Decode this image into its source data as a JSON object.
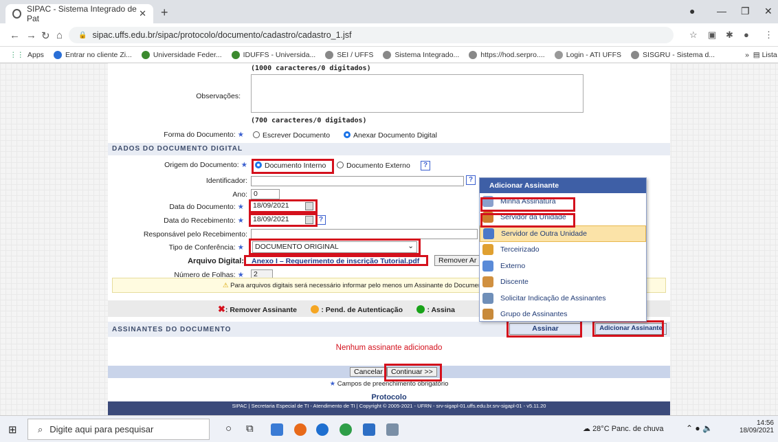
{
  "browser": {
    "tab_title": "SIPAC - Sistema Integrado de Pat",
    "url": "sipac.uffs.edu.br/sipac/protocolo/documento/cadastro/cadastro_1.jsf",
    "bookmarks": [
      "Apps",
      "Entrar no cliente Zi...",
      "Universidade Feder...",
      "IDUFFS - Universida...",
      "SEI / UFFS",
      "Sistema Integrado...",
      "https://hod.serpro....",
      "Login - ATI UFFS",
      "SISGRU - Sistema d..."
    ],
    "reading_list": "Lista de leitura"
  },
  "form": {
    "char_count_1": "(1000 caracteres/0 digitados)",
    "observacoes_label": "Observações:",
    "char_count_2": "(700 caracteres/0 digitados)",
    "forma_label": "Forma do Documento:",
    "forma_opt1": "Escrever Documento",
    "forma_opt2": "Anexar Documento Digital",
    "section_digital": "Dados do Documento Digital",
    "origem_label": "Origem do Documento:",
    "origem_opt1": "Documento Interno",
    "origem_opt2": "Documento Externo",
    "identificador_label": "Identificador:",
    "ano_label": "Ano:",
    "ano_value": "0",
    "data_doc_label": "Data do Documento:",
    "data_doc_value": "18/09/2021",
    "data_rec_label": "Data do Recebimento:",
    "data_rec_value": "18/09/2021",
    "responsavel_label": "Responsável pelo Recebimento:",
    "tipo_label": "Tipo de Conferência:",
    "tipo_value": "DOCUMENTO ORIGINAL",
    "arquivo_label": "Arquivo Digital:",
    "arquivo_value": "Anexo I – Requerimento de inscrição Tutorial.pdf",
    "remover_btn": "Remover Ar",
    "folhas_label": "Número de Folhas:",
    "folhas_value": "2",
    "warning": "Para arquivos digitais será necessário informar pelo menos um Assinante do Documen",
    "legend_remove": ": Remover Assinante",
    "legend_pend": ": Pend. de Autenticação",
    "legend_assin": ": Assina",
    "section_assinantes": "Assinantes do Documento",
    "assinar_btn": "Assinar",
    "adicionar_btn": "Adicionar Assinante",
    "nenhum": "Nenhum assinante adicionado",
    "cancelar_btn": "Cancelar",
    "continuar_btn": "Continuar >>",
    "campos": "Campos de preenchimento obrigatório",
    "protocolo": "Protocolo",
    "footer": "SIPAC | Secretaria Especial de TI - Atendimento de TI | Copyright © 2005-2021 - UFRN - srv-sigapl-01.uffs.edu.br.srv-sigapl-01 - v5.11.20"
  },
  "menu": {
    "title": "Adicionar Assinante",
    "items": [
      "Minha Assinatura",
      "Servidor da Unidade",
      "Servidor de Outra Unidade",
      "Terceirizado",
      "Externo",
      "Discente",
      "Solicitar Indicação de Assinantes",
      "Grupo de Assinantes"
    ]
  },
  "taskbar": {
    "search_placeholder": "Digite aqui para pesquisar",
    "weather": "28°C  Panc. de chuva",
    "time": "14:56",
    "date": "18/09/2021"
  }
}
